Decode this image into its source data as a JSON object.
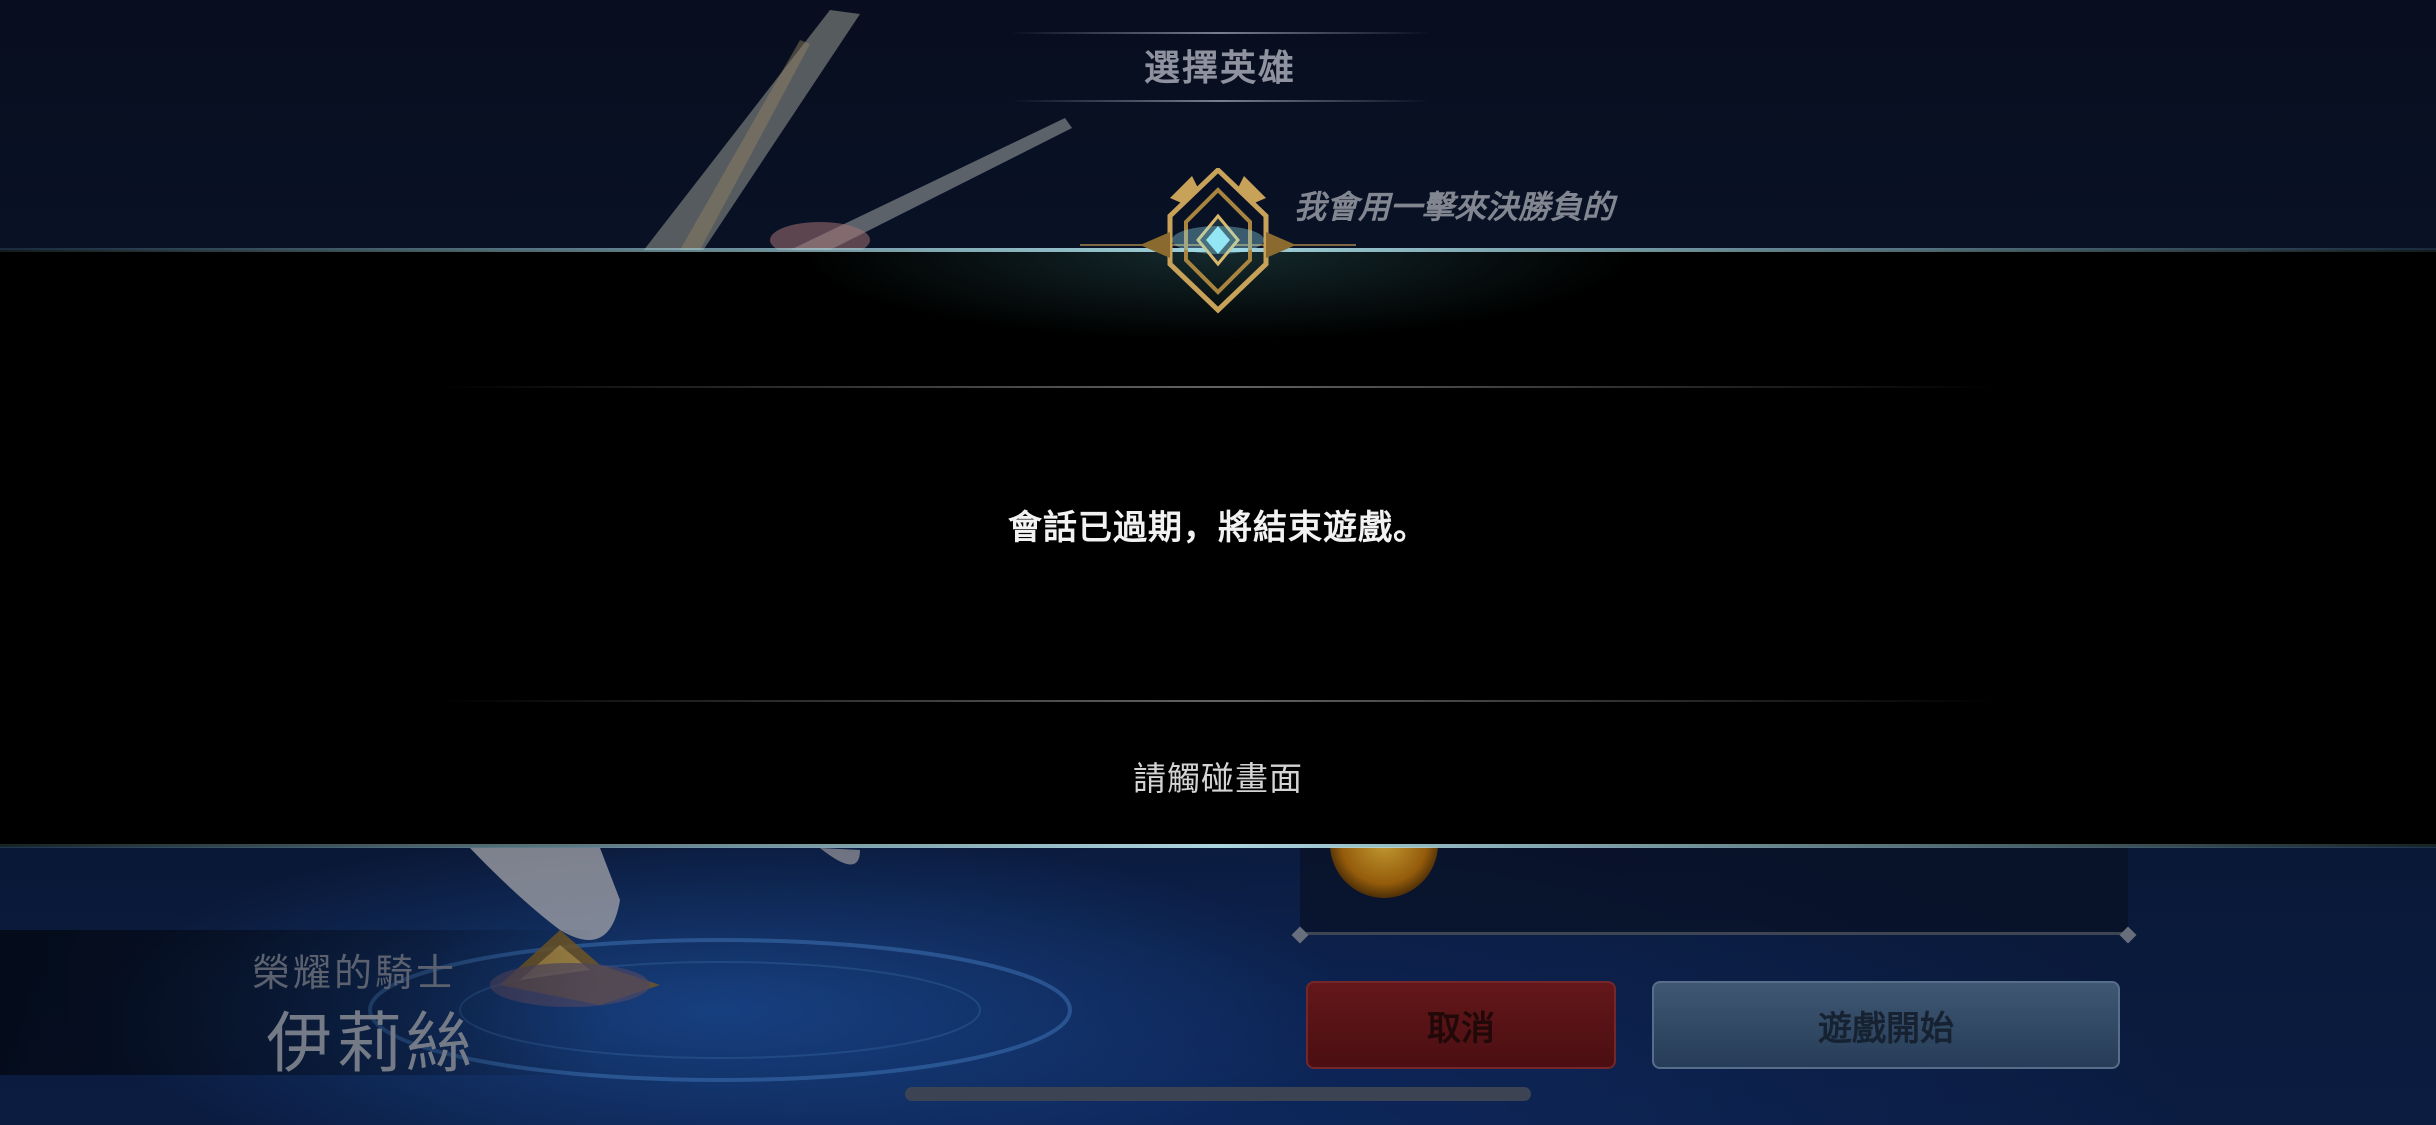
{
  "header": {
    "title": "選擇英雄"
  },
  "hero": {
    "quote": "我會用一擊來決勝負的",
    "epithet": "榮耀的騎士",
    "name": "伊莉絲"
  },
  "actions": {
    "cancel_label": "取消",
    "start_label": "遊戲開始"
  },
  "dialog": {
    "message": "會話已過期，將結束遊戲。",
    "prompt": "請觸碰畫面"
  },
  "colors": {
    "dialog_bg": "#000000",
    "accent_glow": "#aadce6",
    "gold": "#c9a25a",
    "cancel": "#6a171b",
    "start": "#3e5a7c"
  }
}
